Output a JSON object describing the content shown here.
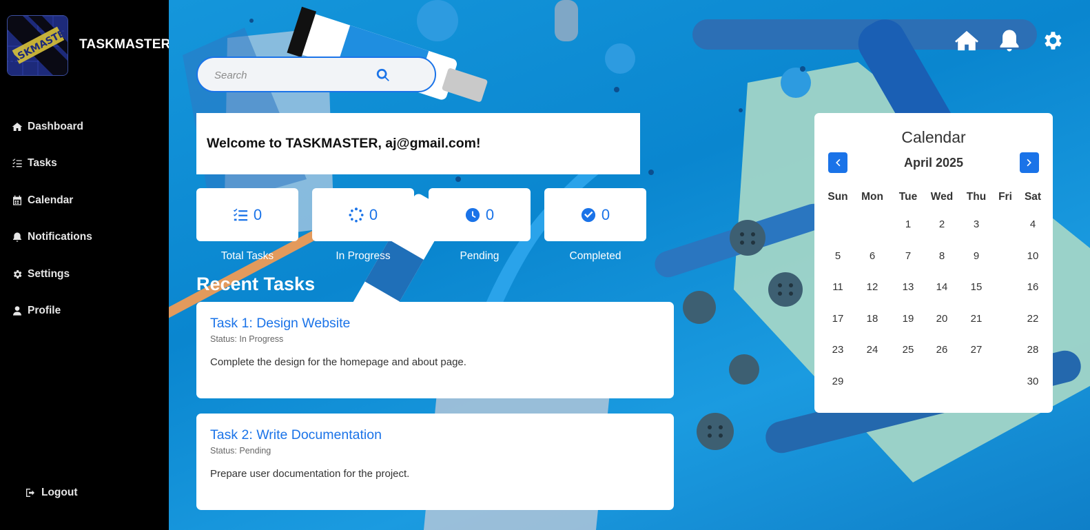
{
  "app": {
    "brand": "TASKMASTER",
    "logo_text": "TASKMASTER"
  },
  "sidebar": {
    "items": [
      {
        "label": "Dashboard",
        "icon": "home-icon"
      },
      {
        "label": "Tasks",
        "icon": "tasks-list-icon"
      },
      {
        "label": "Calendar",
        "icon": "calendar-icon"
      },
      {
        "label": "Notifications",
        "icon": "bell-icon"
      },
      {
        "label": "Settings",
        "icon": "gear-icon"
      },
      {
        "label": "Profile",
        "icon": "user-icon"
      }
    ],
    "logout_label": "Logout"
  },
  "topbar": {
    "icons": [
      "home-icon",
      "bell-icon",
      "gear-icon"
    ]
  },
  "search": {
    "placeholder": "Search",
    "value": ""
  },
  "welcome": {
    "text": "Welcome to TASKMASTER, aj@gmail.com!"
  },
  "stats": [
    {
      "label": "Total Tasks",
      "value": "0",
      "icon": "task-list-icon"
    },
    {
      "label": "In Progress",
      "value": "0",
      "icon": "spinner-icon"
    },
    {
      "label": "Pending",
      "value": "0",
      "icon": "clock-icon"
    },
    {
      "label": "Completed",
      "value": "0",
      "icon": "check-circle-icon"
    }
  ],
  "recent": {
    "title": "Recent Tasks",
    "tasks": [
      {
        "title": "Task 1: Design Website",
        "status": "Status: In Progress",
        "description": "Complete the design for the homepage and about page."
      },
      {
        "title": "Task 2: Write Documentation",
        "status": "Status: Pending",
        "description": "Prepare user documentation for the project."
      }
    ]
  },
  "calendar": {
    "title": "Calendar",
    "month": "April 2025",
    "weekdays": [
      "Sun",
      "Mon",
      "Tue",
      "Wed",
      "Thu",
      "Fri",
      "Sat"
    ],
    "weeks": [
      [
        "",
        "",
        "1",
        "2",
        "3",
        "",
        "4"
      ],
      [
        "5",
        "6",
        "7",
        "8",
        "9",
        "",
        "10"
      ],
      [
        "11",
        "12",
        "13",
        "14",
        "15",
        "",
        "16"
      ],
      [
        "17",
        "18",
        "19",
        "20",
        "21",
        "",
        "22"
      ],
      [
        "23",
        "24",
        "25",
        "26",
        "27",
        "",
        "28"
      ],
      [
        "29",
        "",
        "",
        "",
        "",
        "",
        "30"
      ]
    ]
  },
  "colors": {
    "accent": "#1a73e8",
    "sidebar_bg": "#000000",
    "background": "#1596db"
  }
}
